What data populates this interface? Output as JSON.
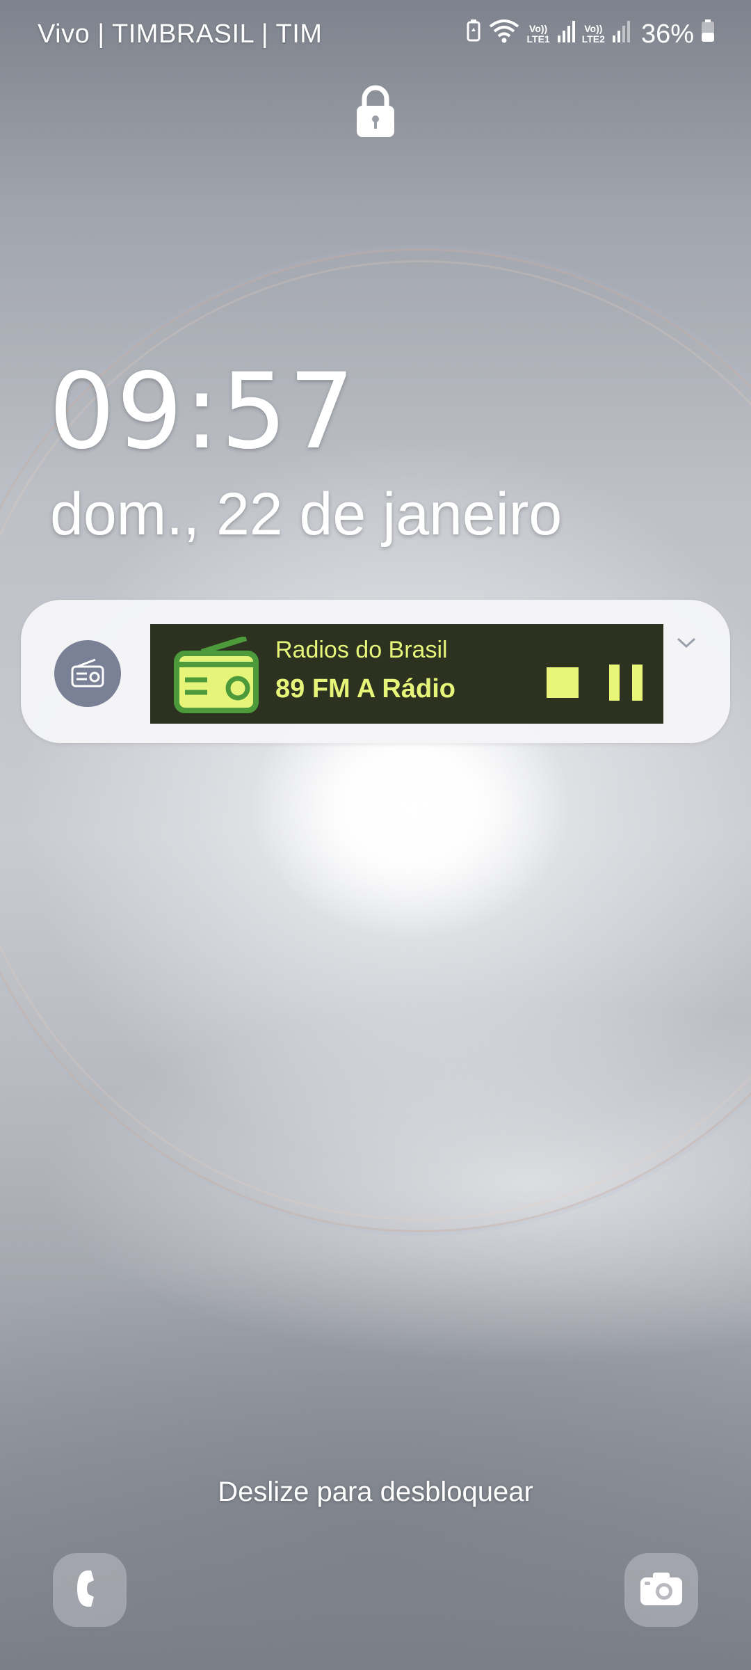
{
  "status_bar": {
    "carrier": "Vivo | TIMBRASIL | TIM",
    "sim1_label_top": "Vo))",
    "sim1_label_bottom": "LTE1",
    "sim2_label_top": "Vo))",
    "sim2_label_bottom": "LTE2",
    "battery_percent": "36%"
  },
  "lockscreen": {
    "time": "09:57",
    "date": "dom., 22 de janeiro",
    "swipe_hint": "Deslize para desbloquear"
  },
  "notification": {
    "app_name": "Radios do Brasil",
    "station": "89 FM A Rádio",
    "colors": {
      "player_bg": "#2c3120",
      "accent": "#e6f57a",
      "card_bg": "#f5f5f7"
    }
  },
  "icons": {
    "lock": "lock-icon",
    "app": "radio-icon",
    "stop": "stop-icon",
    "pause": "pause-icon",
    "expand": "chevron-down-icon",
    "phone": "phone-icon",
    "camera": "camera-icon"
  }
}
